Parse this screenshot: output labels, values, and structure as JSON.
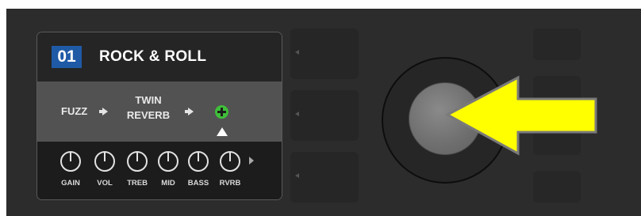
{
  "preset": {
    "number": "01",
    "name": "ROCK & ROLL"
  },
  "signal_chain": {
    "items": [
      {
        "label": "FUZZ"
      },
      {
        "label_line1": "TWIN",
        "label_line2": "REVERB"
      }
    ],
    "add_icon": "plus-circle-icon",
    "selector_icon": "caret-up-icon"
  },
  "knobs": [
    {
      "label": "GAIN"
    },
    {
      "label": "VOL"
    },
    {
      "label": "TREB"
    },
    {
      "label": "MID"
    },
    {
      "label": "BASS"
    },
    {
      "label": "RVRB"
    }
  ],
  "colors": {
    "panel": "#2c2c2c",
    "preset_badge": "#1f5aa6",
    "add_icon": "#3fbe3a",
    "pointer_arrow": "#ffff00"
  }
}
